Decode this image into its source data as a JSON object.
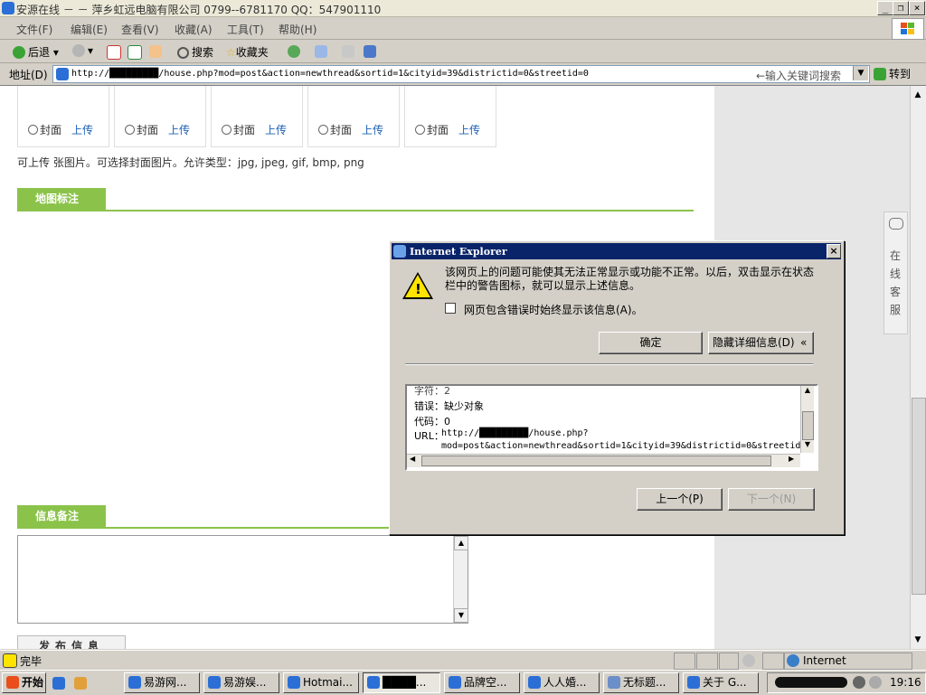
{
  "window": {
    "title": "安源在线 － － 萍乡虹远电脑有限公司  0799--6781170    QQ：547901110",
    "controls": [
      "_",
      "❐",
      "×"
    ]
  },
  "menu": [
    "文件(F)",
    "编辑(E)",
    "查看(V)",
    "收藏(A)",
    "工具(T)",
    "帮助(H)"
  ],
  "toolbar": {
    "back": "后退",
    "search": "搜索",
    "favorites": "收藏夹"
  },
  "address": {
    "label": "地址(D)",
    "url": "http://█████████/house.php?mod=post&action=newthread&sortid=1&cityid=39&districtid=0&streetid=0",
    "search_placeholder": "←输入关键词搜索",
    "go": "转到"
  },
  "page": {
    "thumbs": [
      {
        "cover": "封面",
        "upload": "上传"
      },
      {
        "cover": "封面",
        "upload": "上传"
      },
      {
        "cover": "封面",
        "upload": "上传"
      },
      {
        "cover": "封面",
        "upload": "上传"
      },
      {
        "cover": "封面",
        "upload": "上传"
      }
    ],
    "upload_hint": "可上传 张图片。可选择封面图片。允许类型：jpg, jpeg, gif, bmp, png",
    "section_map": "地图标注",
    "section_notes": "信息备注",
    "publish_button": "发布信息",
    "online_service": [
      "在",
      "线",
      "客",
      "服"
    ]
  },
  "dialog": {
    "title": "Internet Explorer",
    "message": "该网页上的问题可能使其无法正常显示或功能不正常。以后，双击显示在状态栏中的警告图标，就可以显示上述信息。",
    "checkbox": "网页包含错误时始终显示该信息(A)。",
    "ok": "确定",
    "hide_details": "隐藏详细信息(D)",
    "details": {
      "char": "字符：2",
      "error": "错误：缺少对象",
      "code": "代码：0",
      "url_label": "URL：",
      "url_line1": "http://█████████/house.php?",
      "url_line2": "mod=post&action=newthread&sortid=1&cityid=39&districtid=0&streetid"
    },
    "prev": "上一个(P)",
    "next": "下一个(N)"
  },
  "status": {
    "text": "完毕",
    "zone": "Internet"
  },
  "taskbar": {
    "start": "开始",
    "tasks": [
      "易游网...",
      "易游娱...",
      "Hotmai...",
      "████...",
      "品牌空...",
      "人人婚...",
      "无标题...",
      "关于 G..."
    ],
    "clock": "19:16"
  }
}
